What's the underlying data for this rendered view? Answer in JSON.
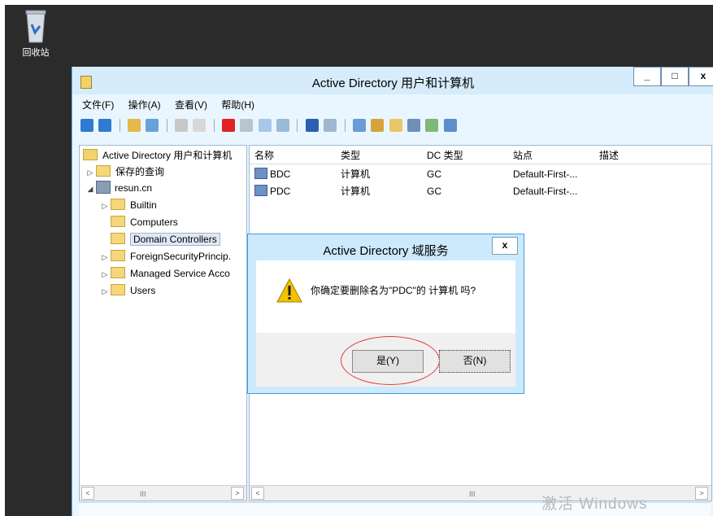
{
  "desktop": {
    "recycle_bin_label": "回收站"
  },
  "window": {
    "title": "Active Directory 用户和计算机",
    "min": "_",
    "max": "□",
    "close": "x"
  },
  "menu": [
    "文件(F)",
    "操作(A)",
    "查看(V)",
    "帮助(H)"
  ],
  "tree": {
    "root": "Active Directory 用户和计算机",
    "saved_queries": "保存的查询",
    "domain": "resun.cn",
    "children": [
      "Builtin",
      "Computers",
      "Domain Controllers",
      "ForeignSecurityPrincip.",
      "Managed Service Acco",
      "Users"
    ],
    "expanders": [
      "▷",
      "◢",
      "▷",
      "▷",
      "▷",
      "▷"
    ]
  },
  "list": {
    "columns": [
      "名称",
      "类型",
      "DC 类型",
      "站点",
      "描述"
    ],
    "rows": [
      {
        "name": "BDC",
        "type": "计算机",
        "dc_type": "GC",
        "site": "Default-First-..."
      },
      {
        "name": "PDC",
        "type": "计算机",
        "dc_type": "GC",
        "site": "Default-First-..."
      }
    ]
  },
  "scroll": {
    "left": "<",
    "right": ">",
    "thumb": "III"
  },
  "dialog": {
    "title": "Active Directory 域服务",
    "close": "x",
    "message": "你确定要删除名为\"PDC\"的 计算机 吗?",
    "yes": "是(Y)",
    "no": "否(N)"
  },
  "watermark": "激活 Windows",
  "colors": {
    "accent": "#3aa0e5",
    "annotation": "#e23a3a",
    "warning": "#f2c200"
  }
}
